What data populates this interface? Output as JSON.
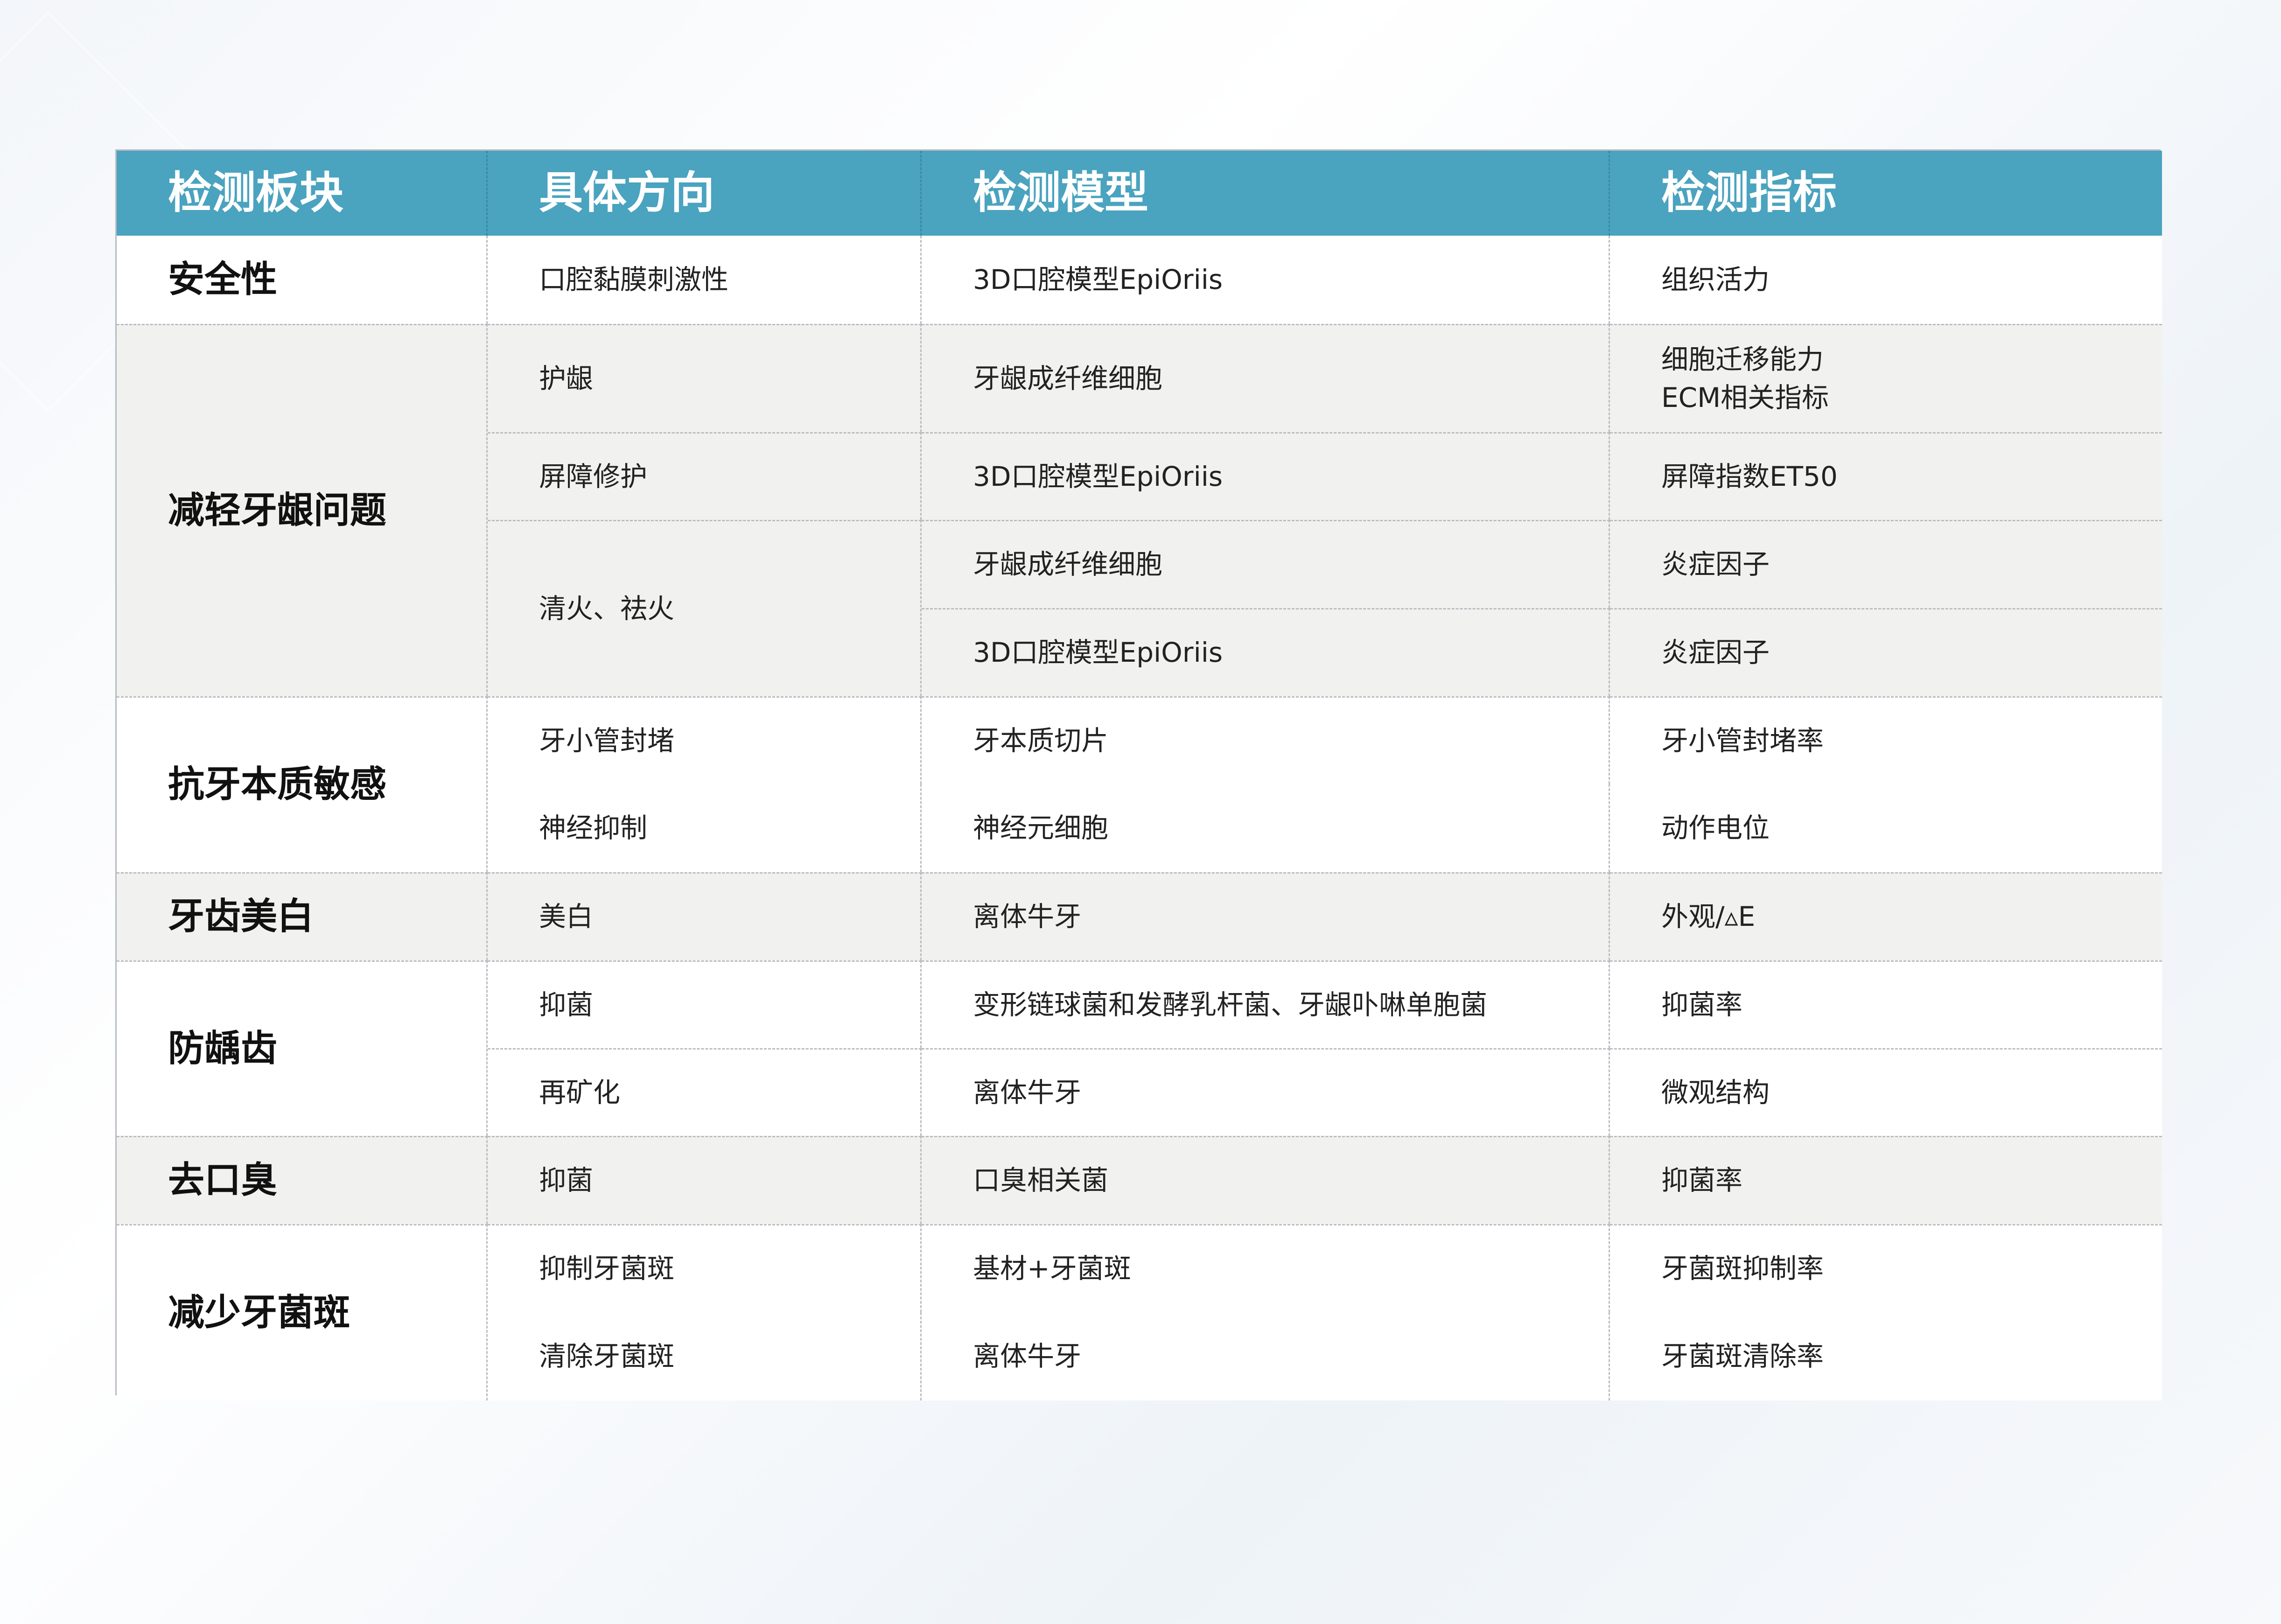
{
  "header": [
    "检测板块",
    "具体方向",
    "检测模型",
    "检测指标"
  ],
  "rows": [
    {
      "section": "安全性",
      "direction": "口腔黏膜刺激性",
      "model": "3D口腔模型EpiOriis",
      "indicator": "组织活力"
    },
    {
      "section": "减轻牙龈问题",
      "direction": "护龈",
      "model": "牙龈成纤维细胞",
      "indicator_lines": [
        "细胞迁移能力",
        "ECM相关指标"
      ]
    },
    {
      "direction": "屏障修护",
      "model": "3D口腔模型EpiOriis",
      "indicator": "屏障指数ET50"
    },
    {
      "direction": "清火、祛火",
      "model": "牙龈成纤维细胞",
      "indicator": "炎症因子"
    },
    {
      "model": "3D口腔模型EpiOriis",
      "indicator": "炎症因子"
    },
    {
      "section": "抗牙本质敏感",
      "direction": "牙小管封堵",
      "model": "牙本质切片",
      "indicator": "牙小管封堵率"
    },
    {
      "direction": "神经抑制",
      "model": "神经元细胞",
      "indicator": "动作电位"
    },
    {
      "section": "牙齿美白",
      "direction": "美白",
      "model": "离体牛牙",
      "indicator": "外观/▵E"
    },
    {
      "section": "防龋齿",
      "direction": "抑菌",
      "model": "变形链球菌和发酵乳杆菌、牙龈卟啉单胞菌",
      "indicator": "抑菌率"
    },
    {
      "direction": "再矿化",
      "model": "离体牛牙",
      "indicator": "微观结构"
    },
    {
      "section": "去口臭",
      "direction": "抑菌",
      "model": "口臭相关菌",
      "indicator": "抑菌率"
    },
    {
      "section": "减少牙菌斑",
      "direction": "抑制牙菌斑",
      "model": "基材+牙菌斑",
      "indicator": "牙菌斑抑制率"
    },
    {
      "direction": "清除牙菌斑",
      "model": "离体牛牙",
      "indicator": "牙菌斑清除率"
    }
  ],
  "colors": {
    "header_bg": "#4aa3bf",
    "header_text": "#ffffff",
    "row_alt": "#f1f1ef",
    "border": "#b9bdc1"
  }
}
